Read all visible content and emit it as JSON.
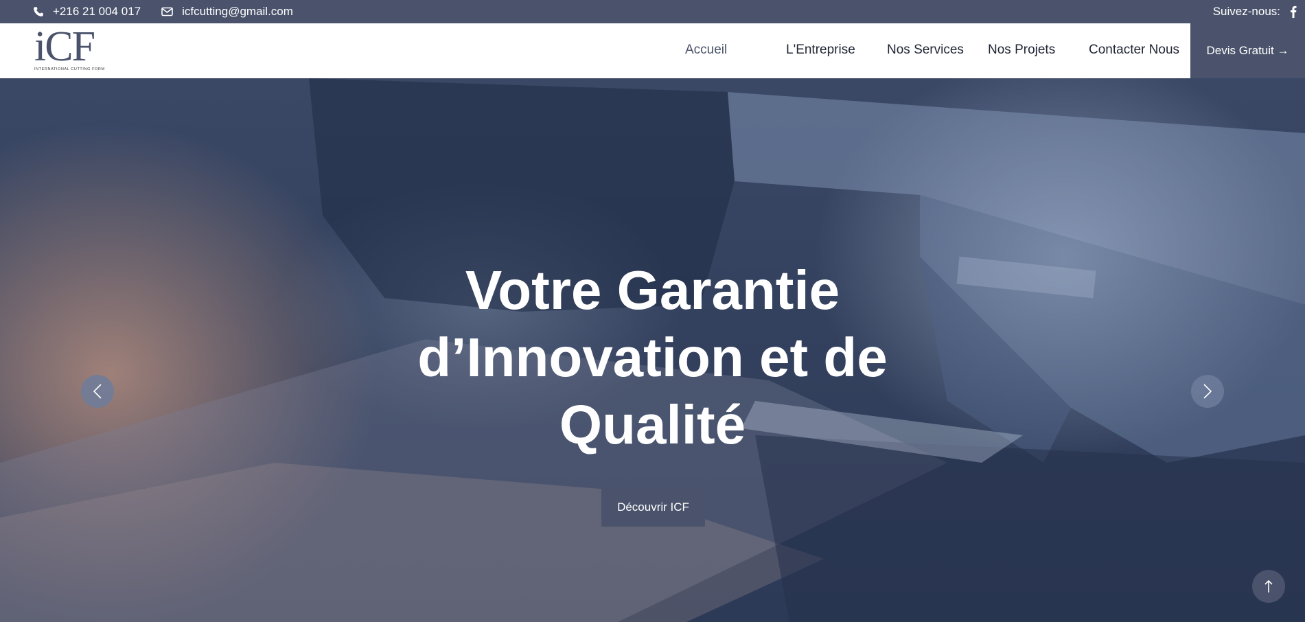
{
  "topbar": {
    "phone": "+216 21 004 017",
    "email": "icfcutting@gmail.com",
    "follow_label": "Suivez-nous:",
    "phone_icon": "phone-icon",
    "email_icon": "envelope-icon",
    "social_icon": "facebook-icon"
  },
  "header": {
    "logo_mark": "iCF",
    "logo_tagline": "INTERNATIONAL CUTTING FORM",
    "nav": [
      {
        "label": "Accueil",
        "active": true
      },
      {
        "label": "L'Entreprise"
      },
      {
        "label": "Nos Services"
      },
      {
        "label": "Nos Projets"
      },
      {
        "label": "Contacter Nous"
      }
    ],
    "cta_label": "Devis Gratuit →"
  },
  "hero": {
    "headline_lines": [
      "Votre Garantie",
      "d’Innovation et de",
      "Qualité"
    ],
    "button_label": "Découvrir ICF",
    "prev_icon": "chevron-left-icon",
    "next_icon": "chevron-right-icon"
  },
  "scroll_top_icon": "arrow-up-icon",
  "colors": {
    "primary": "#4a536b",
    "topbar_bg": "#4a536b",
    "header_bg": "#ffffff",
    "text_dark": "#1f2533",
    "hero_text": "#ffffff"
  }
}
